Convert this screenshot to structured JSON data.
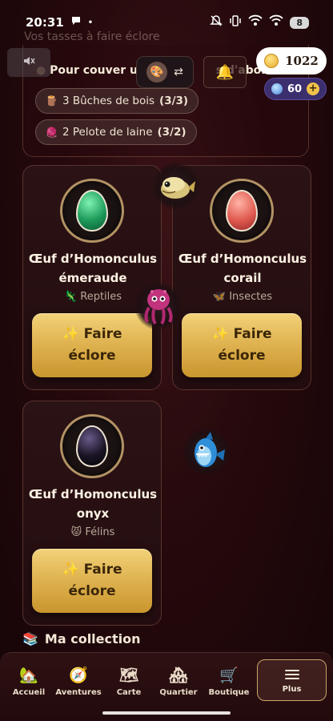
{
  "status_bar": {
    "time": "20:31",
    "battery": "8"
  },
  "top": {
    "faded_text": "Vos tasses à faire éclore",
    "couver_text": "Pour couver un",
    "couver_text_tail": "s d'abord un",
    "coins": "1022",
    "gems": "60",
    "requirements": [
      {
        "icon": "log-icon",
        "text": "3 Bûches de bois",
        "count": "(3/3)"
      },
      {
        "icon": "yarn-icon",
        "text": "2 Pelote de laine",
        "count": "(3/2)"
      }
    ]
  },
  "eggs": [
    {
      "name_line1": "Œuf d’Homonculus",
      "name_line2": "émeraude",
      "type_icon": "🦎",
      "type": "Reptiles",
      "button_line1": "Faire",
      "button_line2": "éclore",
      "color": "#1d9a5a"
    },
    {
      "name_line1": "Œuf d’Homonculus",
      "name_line2": "corail",
      "type_icon": "🦋",
      "type": "Insectes",
      "button_line1": "Faire",
      "button_line2": "éclore",
      "color": "#e05a50"
    },
    {
      "name_line1": "Œuf d’Homonculus",
      "name_line2": "onyx",
      "type_icon": "😾",
      "type": "Félins",
      "button_line1": "Faire",
      "button_line2": "éclore",
      "color": "#1a1424"
    }
  ],
  "collection_label": "Ma collection",
  "nav": {
    "items": [
      {
        "label": "Accueil",
        "icon": "home-icon"
      },
      {
        "label": "Aventures",
        "icon": "compass-icon"
      },
      {
        "label": "Carte",
        "icon": "map-icon"
      },
      {
        "label": "Quartier",
        "icon": "district-icon"
      },
      {
        "label": "Boutique",
        "icon": "cart-icon"
      }
    ],
    "more_label": "Plus"
  }
}
